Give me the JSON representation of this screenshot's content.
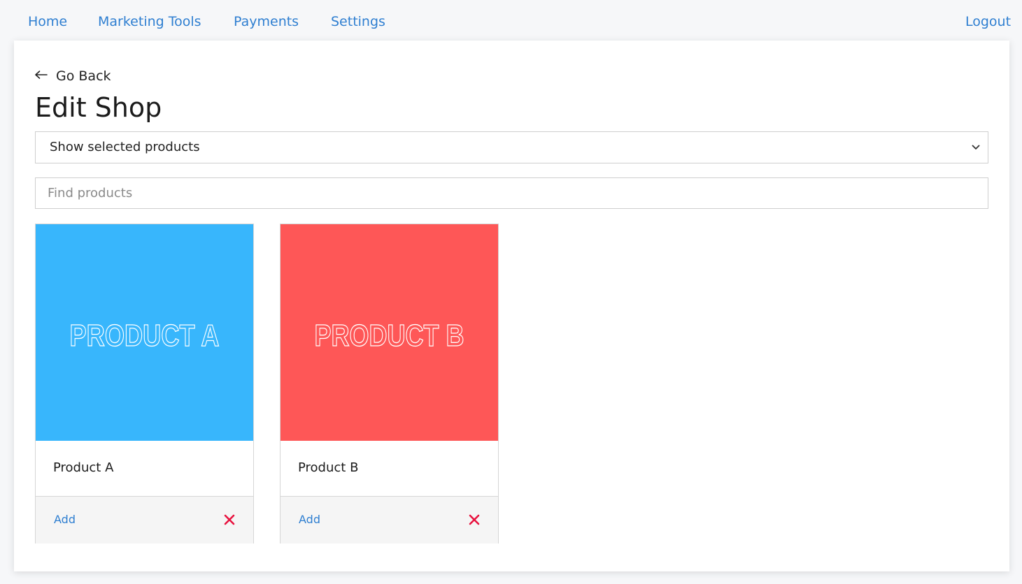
{
  "nav": {
    "items": [
      {
        "label": "Home"
      },
      {
        "label": "Marketing Tools"
      },
      {
        "label": "Payments"
      },
      {
        "label": "Settings"
      }
    ],
    "logout_label": "Logout"
  },
  "page": {
    "go_back_label": "Go Back",
    "title": "Edit Shop"
  },
  "filter_select": {
    "selected": "Show selected products"
  },
  "search": {
    "placeholder": "Find products",
    "value": ""
  },
  "products": [
    {
      "name": "Product A",
      "image_text": "PRODUCT A",
      "image_color": "#38b6fc",
      "add_label": "Add",
      "remove_icon": "close-icon"
    },
    {
      "name": "Product B",
      "image_text": "PRODUCT B",
      "image_color": "#fe5757",
      "add_label": "Add",
      "remove_icon": "close-icon"
    }
  ],
  "colors": {
    "link": "#2f7fd1",
    "remove": "#e8133f"
  }
}
